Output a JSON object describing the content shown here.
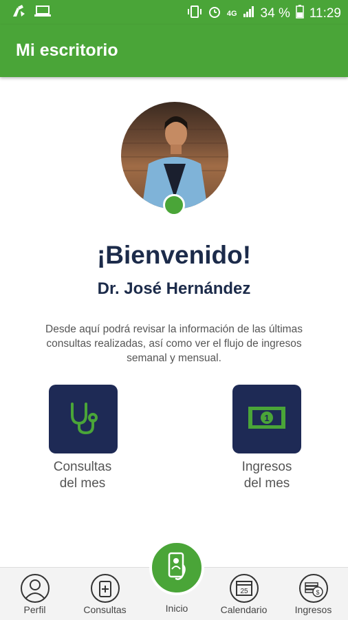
{
  "status": {
    "battery_percent": "34 %",
    "time": "11:29",
    "network": "4G"
  },
  "appbar": {
    "title": "Mi escritorio"
  },
  "profile": {
    "welcome": "¡Bienvenido!",
    "name": "Dr. José Hernández",
    "description": "Desde aquí podrá revisar la información de las últimas consultas realizadas, así como ver el flujo de ingresos semanal y mensual."
  },
  "tiles": [
    {
      "line1": "Consultas",
      "line2": "del mes",
      "icon": "stethoscope-icon"
    },
    {
      "line1": "Ingresos",
      "line2": "del mes",
      "icon": "banknote-icon"
    }
  ],
  "nav": {
    "items": [
      {
        "label": "Perfil",
        "icon": "profile-icon"
      },
      {
        "label": "Consultas",
        "icon": "medicine-icon"
      },
      {
        "label": "Inicio",
        "icon": "home-phone-icon"
      },
      {
        "label": "Calendario",
        "icon": "calendar-icon",
        "day": "25"
      },
      {
        "label": "Ingresos",
        "icon": "coins-icon"
      }
    ]
  },
  "colors": {
    "primary": "#4aa538",
    "navy": "#1e2a55"
  }
}
